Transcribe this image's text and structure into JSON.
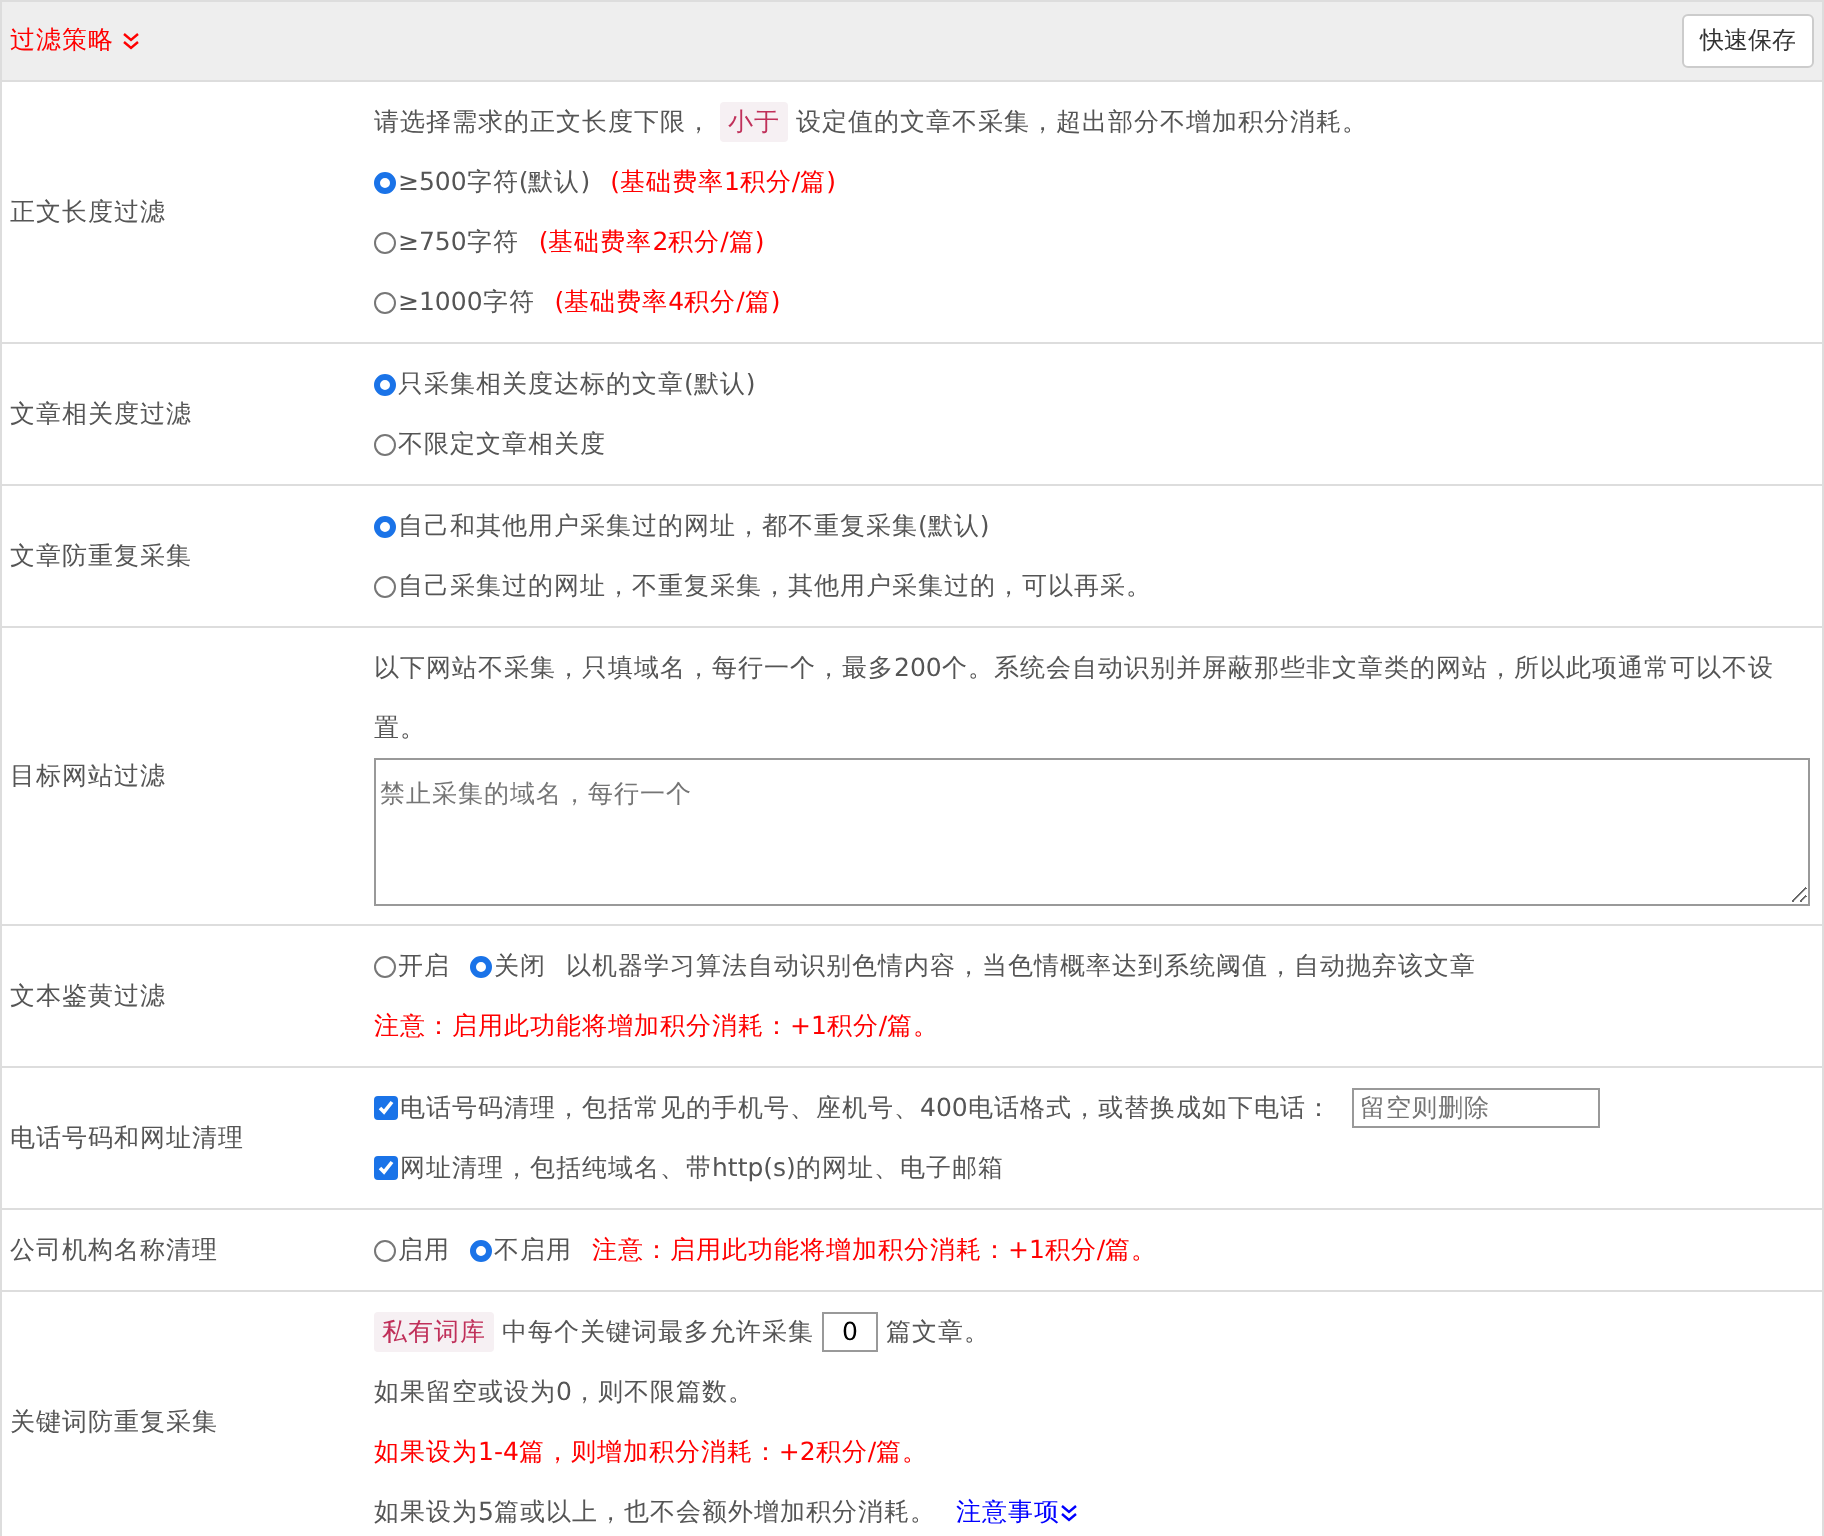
{
  "header": {
    "title": "过滤策略",
    "save_button": "快速保存"
  },
  "rows": [
    {
      "label": "正文长度过滤",
      "lines": [
        [
          {
            "kind": "text",
            "text": "请选择需求的正文长度下限，"
          },
          {
            "kind": "tag",
            "text": "小于"
          },
          {
            "kind": "text",
            "text": "设定值的文章不采集，超出部分不增加积分消耗。"
          }
        ],
        [
          {
            "kind": "radio",
            "text": "≥500字符(默认)",
            "selected": true
          },
          {
            "kind": "note",
            "text": "(基础费率1积分/篇)"
          }
        ],
        [
          {
            "kind": "radio",
            "text": "≥750字符",
            "selected": false
          },
          {
            "kind": "note",
            "text": "(基础费率2积分/篇)"
          }
        ],
        [
          {
            "kind": "radio",
            "text": "≥1000字符",
            "selected": false
          },
          {
            "kind": "note",
            "text": "(基础费率4积分/篇)"
          }
        ]
      ]
    },
    {
      "label": "文章相关度过滤",
      "lines": [
        [
          {
            "kind": "radio",
            "text": "只采集相关度达标的文章(默认)",
            "selected": true
          }
        ],
        [
          {
            "kind": "radio",
            "text": "不限定文章相关度",
            "selected": false
          }
        ]
      ]
    },
    {
      "label": "文章防重复采集",
      "lines": [
        [
          {
            "kind": "radio",
            "text": "自己和其他用户采集过的网址，都不重复采集(默认)",
            "selected": true
          }
        ],
        [
          {
            "kind": "radio",
            "text": "自己采集过的网址，不重复采集，其他用户采集过的，可以再采。",
            "selected": false
          }
        ]
      ]
    },
    {
      "label": "目标网站过滤",
      "lines": [
        [
          {
            "kind": "text",
            "text": "以下网站不采集，只填域名，每行一个，最多200个。系统会自动识别并屏蔽那些非文章类的网站，所以此项通常可以不设置。"
          }
        ],
        [
          {
            "kind": "textarea",
            "placeholder": "禁止采集的域名，每行一个"
          }
        ]
      ]
    },
    {
      "label": "文本鉴黄过滤",
      "lines": [
        [
          {
            "kind": "radio",
            "text": "开启",
            "selected": false
          },
          {
            "kind": "radio",
            "text": "关闭",
            "selected": true
          },
          {
            "kind": "text",
            "text": "以机器学习算法自动识别色情内容，当色情概率达到系统阈值，自动抛弃该文章"
          }
        ],
        [
          {
            "kind": "note",
            "text": "注意：启用此功能将增加积分消耗：+1积分/篇。"
          }
        ]
      ]
    },
    {
      "label": "电话号码和网址清理",
      "lines": [
        [
          {
            "kind": "checkbox",
            "text": "电话号码清理，包括常见的手机号、座机号、400电话格式，或替换成如下电话：",
            "checked": true
          },
          {
            "kind": "input",
            "placeholder": "留空则删除"
          }
        ],
        [
          {
            "kind": "checkbox",
            "text": "网址清理，包括纯域名、带http(s)的网址、电子邮箱",
            "checked": true
          }
        ]
      ]
    },
    {
      "label": "公司机构名称清理",
      "lines": [
        [
          {
            "kind": "radio",
            "text": "启用",
            "selected": false
          },
          {
            "kind": "radio",
            "text": "不启用",
            "selected": true
          },
          {
            "kind": "note",
            "text": "注意：启用此功能将增加积分消耗：+1积分/篇。"
          }
        ]
      ]
    },
    {
      "label": "关键词防重复采集",
      "lines": [
        [
          {
            "kind": "tag",
            "text": "私有词库"
          },
          {
            "kind": "text",
            "text": "中每个关键词最多允许采集"
          },
          {
            "kind": "number",
            "value": "0"
          },
          {
            "kind": "text",
            "text": "篇文章。"
          }
        ],
        [
          {
            "kind": "text",
            "text": "如果留空或设为0，则不限篇数。"
          }
        ],
        [
          {
            "kind": "note",
            "text": "如果设为1-4篇，则增加积分消耗：+2积分/篇。"
          }
        ],
        [
          {
            "kind": "text",
            "text": "如果设为5篇或以上，也不会额外增加积分消耗。"
          },
          {
            "kind": "link",
            "text": "注意事项"
          }
        ]
      ]
    }
  ]
}
